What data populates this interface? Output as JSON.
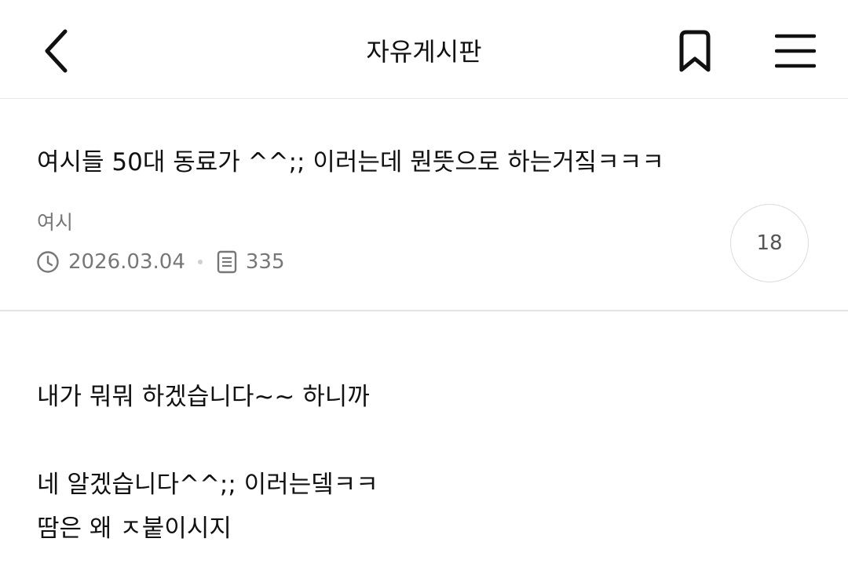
{
  "header": {
    "board_title": "자유게시판"
  },
  "post": {
    "title": "여시들 50대 동료가 ^^;; 이러는데 뭔뜻으로 하는거짘ㅋㅋㅋ",
    "author": "여시",
    "date": "2026.03.04",
    "views": "335",
    "comment_count": "18",
    "body": [
      "내가 뭐뭐 하겠습니다~~ 하니까",
      "",
      "네 알겠습니다^^;; 이러는뎈ㅋㅋ",
      "땀은 왜 ㅈ붙이시지"
    ]
  },
  "icons": {
    "back": "chevron-left-icon",
    "bookmark": "bookmark-icon",
    "menu": "hamburger-menu-icon",
    "clock": "clock-icon",
    "views": "document-list-icon"
  }
}
